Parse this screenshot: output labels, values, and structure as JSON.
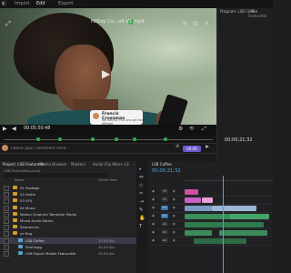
{
  "menu": {
    "items": [
      "Import",
      "Edit",
      "Export"
    ]
  },
  "video": {
    "title": "Hilltop Co...ult V1.mp4",
    "play_icon": "▶",
    "timecode": "00:05:50:48",
    "comment_author": "Francis Crossman",
    "comment_text": "Na kaluny ma una pe kia diffrest",
    "colors": {
      "marker": "#2fae52",
      "accent": "#6a5acd"
    }
  },
  "comment_input": {
    "placeholder": "Leave your comment here...",
    "send_label": "00:40"
  },
  "program_monitor": {
    "tab": "Program: LSB Coffee",
    "tab2": "LSB Featurette",
    "timecode": "00;00;21;32"
  },
  "project": {
    "tabs": [
      "Project: LSB Featurette",
      "Media Browser",
      "Markers",
      "Audio Clip Mixer: LS"
    ],
    "path": "LSB Featurette.prproj",
    "search_placeholder": "",
    "columns": [
      "Name",
      "Frame Rate"
    ],
    "rows": [
      {
        "name": "01 Footage",
        "type": "folder",
        "fps": "",
        "indent": 0
      },
      {
        "name": "02 Audio",
        "type": "folder",
        "fps": "",
        "indent": 0
      },
      {
        "name": "03 VFX",
        "type": "folder",
        "fps": "",
        "indent": 0
      },
      {
        "name": "04 Music",
        "type": "folder",
        "fps": "",
        "indent": 0
      },
      {
        "name": "Motion Graphics Template Media",
        "type": "folder",
        "fps": "",
        "indent": 0
      },
      {
        "name": "Mixed Audio Stems",
        "type": "folder",
        "fps": "",
        "indent": 0
      },
      {
        "name": "Sequences",
        "type": "folder",
        "fps": "",
        "indent": 0
      },
      {
        "name": "ye fing",
        "type": "folder",
        "fps": "",
        "indent": 0
      },
      {
        "name": "LSB Coffee",
        "type": "clip",
        "fps": "30.00 fps",
        "indent": 1,
        "selected": true
      },
      {
        "name": "SheVlogg",
        "type": "clip",
        "fps": "30.00 fps",
        "indent": 1
      },
      {
        "name": "LSB Export Mobile Featurette",
        "type": "clip",
        "fps": "30.00 fps",
        "indent": 1
      }
    ]
  },
  "tools": [
    "▸",
    "⇔",
    "◇",
    "✂",
    "⇥",
    "✎",
    "✋",
    "T"
  ],
  "timeline": {
    "tab": "LSB Coffee",
    "timecode": "00;00;21;32",
    "tracks": [
      "V3",
      "V2",
      "V1",
      "A1",
      "A2",
      "A3",
      "A4"
    ],
    "clips": [
      {
        "track": 0,
        "start": 0.0,
        "len": 0.15,
        "color": "#d14fa6",
        "label": ""
      },
      {
        "track": 1,
        "start": 0.0,
        "len": 0.18,
        "color": "#c962c4",
        "label": ""
      },
      {
        "track": 1,
        "start": 0.2,
        "len": 0.12,
        "color": "#e7a0d9",
        "label": ""
      },
      {
        "track": 2,
        "start": 0.0,
        "len": 0.3,
        "color": "#7a9cc7",
        "label": ""
      },
      {
        "track": 2,
        "start": 0.32,
        "len": 0.5,
        "color": "#9bb7d8",
        "label": ""
      },
      {
        "track": 3,
        "start": 0.0,
        "len": 0.5,
        "color": "#3a8f5a",
        "label": ""
      },
      {
        "track": 3,
        "start": 0.52,
        "len": 0.45,
        "color": "#46a368",
        "label": ""
      },
      {
        "track": 4,
        "start": 0.0,
        "len": 0.9,
        "color": "#2f7c4d",
        "label": ""
      },
      {
        "track": 5,
        "start": 0.0,
        "len": 0.3,
        "color": "#3c8c5b",
        "label": ""
      },
      {
        "track": 5,
        "start": 0.4,
        "len": 0.55,
        "color": "#3c8c5b",
        "label": ""
      },
      {
        "track": 6,
        "start": 0.1,
        "len": 0.6,
        "color": "#2d6b46",
        "label": ""
      }
    ]
  }
}
